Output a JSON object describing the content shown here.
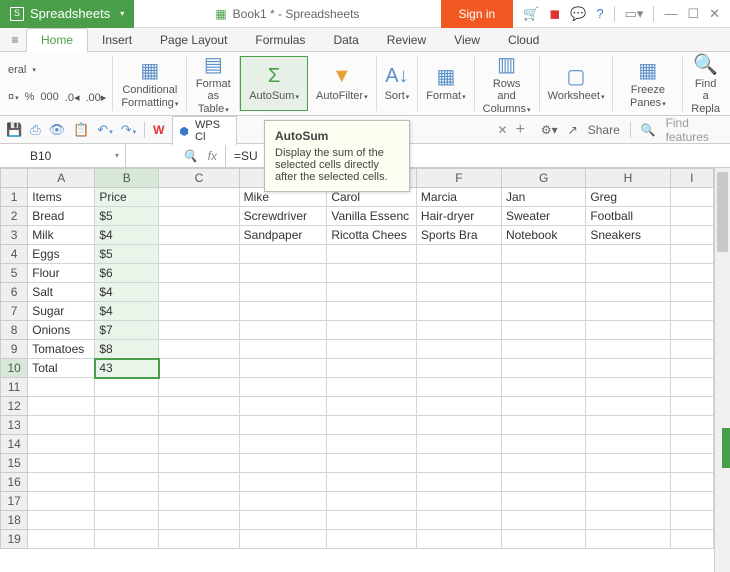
{
  "app_name": "Spreadsheets",
  "document_title": "Book1 * - Spreadsheets",
  "signin_label": "Sign in",
  "tabs": {
    "home": "Home",
    "insert": "Insert",
    "page_layout": "Page Layout",
    "formulas": "Formulas",
    "data": "Data",
    "review": "Review",
    "view": "View",
    "cloud": "Cloud"
  },
  "number_format": "eral",
  "ribbon": {
    "cond_fmt": "Conditional\nFormatting",
    "fmt_table": "Format as\nTable",
    "autosum": "AutoSum",
    "autofilter": "AutoFilter",
    "sort": "Sort",
    "format": "Format",
    "rows_cols": "Rows and\nColumns",
    "worksheet": "Worksheet",
    "freeze": "Freeze Panes",
    "find_repl": "Find a\nRepla"
  },
  "sheet_tab": {
    "wps_label": "WPS Cl"
  },
  "qat": {
    "share": "Share",
    "find": "Find features"
  },
  "namebox": "B10",
  "formula": "=SU",
  "tooltip": {
    "title": "AutoSum",
    "body": "Display the sum of the selected cells directly after the selected cells."
  },
  "columns": [
    "A",
    "B",
    "C",
    "D",
    "E",
    "F",
    "G",
    "H",
    "I"
  ],
  "rows": [
    "1",
    "2",
    "3",
    "4",
    "5",
    "6",
    "7",
    "8",
    "9",
    "10",
    "11",
    "12",
    "13",
    "14",
    "15",
    "16",
    "17",
    "18",
    "19"
  ],
  "cells": {
    "A1": "Items",
    "B1": "Price",
    "D1": "Mike",
    "E1": "Carol",
    "F1": "Marcia",
    "G1": "Jan",
    "H1": "Greg",
    "A2": "Bread",
    "B2": "$5",
    "D2": "Screwdriver",
    "E2": "Vanilla Essenc",
    "F2": "Hair-dryer",
    "G2": "Sweater",
    "H2": "Football",
    "A3": "Milk",
    "B3": "$4",
    "D3": "Sandpaper",
    "E3": "Ricotta Chees",
    "F3": "Sports Bra",
    "G3": "Notebook",
    "H3": "Sneakers",
    "A4": "Eggs",
    "B4": "$5",
    "A5": "Flour",
    "B5": "$6",
    "A6": "Salt",
    "B6": "$4",
    "A7": "Sugar",
    "B7": "$4",
    "A8": "Onions",
    "B8": "$7",
    "A9": "Tomatoes",
    "B9": "$8",
    "A10": "Total",
    "B10": "43"
  },
  "chart_data": {
    "type": "table",
    "title": "Grocery price list",
    "columns": [
      "Items",
      "Price"
    ],
    "rows": [
      [
        "Bread",
        5
      ],
      [
        "Milk",
        4
      ],
      [
        "Eggs",
        5
      ],
      [
        "Flour",
        6
      ],
      [
        "Salt",
        4
      ],
      [
        "Sugar",
        4
      ],
      [
        "Onions",
        7
      ],
      [
        "Tomatoes",
        8
      ],
      [
        "Total",
        43
      ]
    ]
  }
}
